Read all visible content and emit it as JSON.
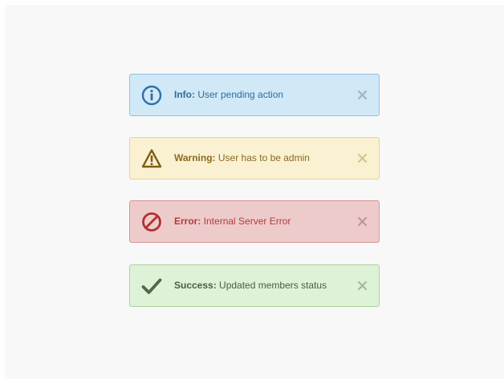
{
  "alerts": [
    {
      "type": "info",
      "label": "Info:",
      "message": " User pending action",
      "icon": "info-circle-icon",
      "colors": {
        "bg": "#d1e8f6",
        "border": "#8fc0e3",
        "text": "#2b6d9e",
        "icon": "#2f6fa8",
        "close": "#9fb3c1"
      }
    },
    {
      "type": "warning",
      "label": "Warning:",
      "message": " User has to be admin",
      "icon": "warning-triangle-icon",
      "colors": {
        "bg": "#faf1d2",
        "border": "#e5d58f",
        "text": "#8a6a1e",
        "icon": "#7f5f14",
        "close": "#d2c58b"
      }
    },
    {
      "type": "error",
      "label": "Error:",
      "message": " Internal Server Error",
      "icon": "prohibited-icon",
      "colors": {
        "bg": "#eecbcb",
        "border": "#d99696",
        "text": "#b53a3a",
        "icon": "#b42f2f",
        "close": "#c29595"
      }
    },
    {
      "type": "success",
      "label": "Success:",
      "message": " Updated members status",
      "icon": "checkmark-icon",
      "colors": {
        "bg": "#ddf2d6",
        "border": "#a9d49b",
        "text": "#4c5d44",
        "icon": "#4f6946",
        "close": "#a6b9a0"
      }
    }
  ]
}
